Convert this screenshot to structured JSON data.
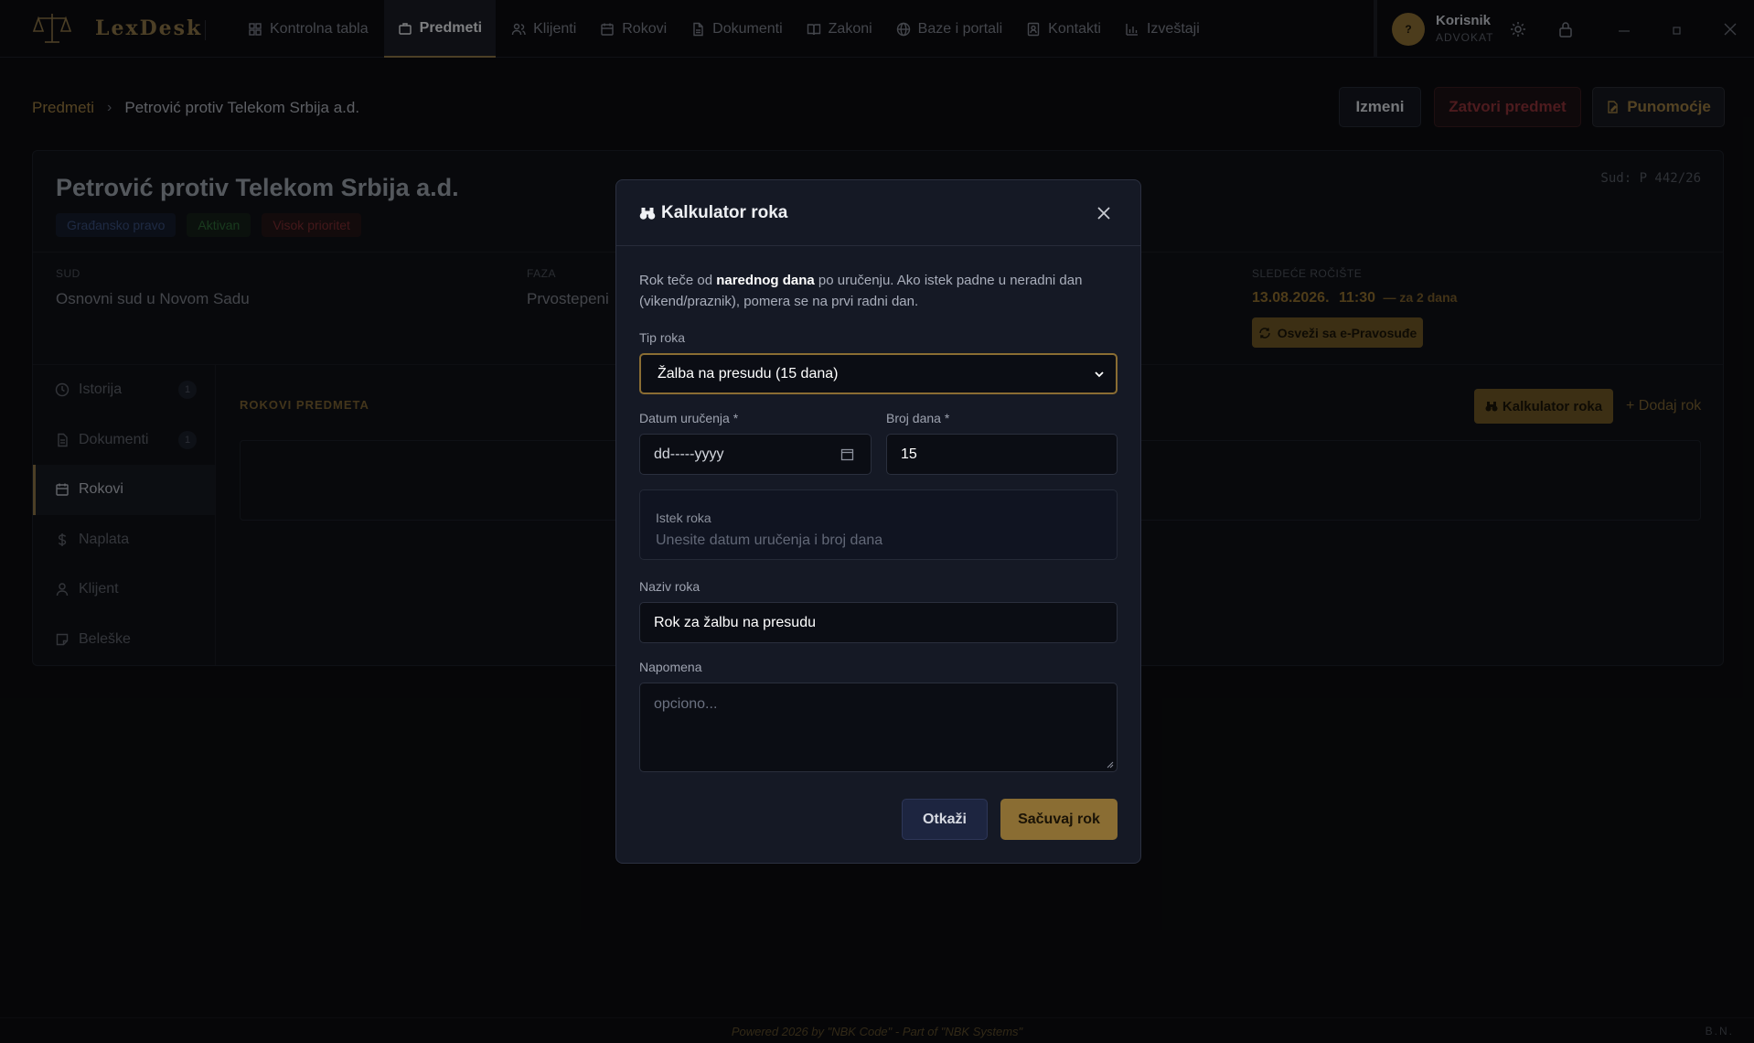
{
  "app": {
    "name": "LexDesk"
  },
  "nav": {
    "items": [
      {
        "label": "Kontrolna tabla",
        "icon": "dashboard-icon"
      },
      {
        "label": "Predmeti",
        "icon": "briefcase-icon"
      },
      {
        "label": "Klijenti",
        "icon": "users-icon"
      },
      {
        "label": "Rokovi",
        "icon": "calendar-icon"
      },
      {
        "label": "Dokumenti",
        "icon": "file-icon"
      },
      {
        "label": "Zakoni",
        "icon": "book-icon"
      },
      {
        "label": "Baze i portali",
        "icon": "globe-icon"
      },
      {
        "label": "Kontakti",
        "icon": "contact-icon"
      },
      {
        "label": "Izveštaji",
        "icon": "bar-chart-icon"
      }
    ],
    "active": "Predmeti"
  },
  "user": {
    "avatar": "?",
    "name": "Korisnik",
    "role": "ADVOKAT"
  },
  "breadcrumb": {
    "parent": "Predmeti",
    "current": "Petrović protiv Telekom Srbija a.d."
  },
  "actions": {
    "izmeni": "Izmeni",
    "zatvori": "Zatvori predmet",
    "punomocje": "Punomoćje"
  },
  "case": {
    "title": "Petrović protiv Telekom Srbija a.d.",
    "sud_code": "Sud: P 442/26",
    "badges": [
      "Građansko pravo",
      "Aktivan",
      "Visok prioritet"
    ],
    "sud_label": "SUD",
    "sud_value": "Osnovni sud u Novom Sadu",
    "faza_label": "FAZA",
    "faza_value": "Prvostepeni",
    "next_label": "SLEDEĆE ROČIŠTE",
    "next_date": "13.08.2026.",
    "next_time": "11:30",
    "next_rel": "— za 2 dana",
    "refresh_label": "Osveži sa e-Pravosuđe"
  },
  "sidebar": {
    "items": [
      {
        "label": "Istorija",
        "count": "1",
        "icon": "clock-icon"
      },
      {
        "label": "Dokumenti",
        "count": "1",
        "icon": "document-icon"
      },
      {
        "label": "Rokovi",
        "count": "",
        "icon": "calendar-icon"
      },
      {
        "label": "Naplata",
        "count": "",
        "icon": "dollar-icon"
      },
      {
        "label": "Klijent",
        "count": "",
        "icon": "user-icon"
      },
      {
        "label": "Beleške",
        "count": "",
        "icon": "note-icon"
      }
    ],
    "active": "Rokovi"
  },
  "rokovi": {
    "title": "ROKOVI PREDMETA",
    "kalkulator": "Kalkulator roka",
    "dodaj": "+ Dodaj rok"
  },
  "modal": {
    "title": "Kalkulator roka",
    "info_1": "Rok teče od ",
    "info_bold": "narednog dana",
    "info_2": " po uručenju. Ako istek padne u neradni dan (vikend/praznik), pomera se na prvi radni dan.",
    "tip_label": "Tip roka",
    "tip_value": "Žalba na presudu (15 dana)",
    "datum_label": "Datum uručenja *",
    "datum_placeholder": "dd-----yyyy",
    "broj_label": "Broj dana *",
    "broj_value": "15",
    "istek_label": "Istek roka",
    "istek_value": "Unesite datum uručenja i broj dana",
    "naziv_label": "Naziv roka",
    "naziv_value": "Rok za žalbu na presudu",
    "napomena_label": "Napomena",
    "napomena_placeholder": "opciono...",
    "cancel": "Otkaži",
    "save": "Sačuvaj rok"
  },
  "footer": {
    "text": "Powered 2026 by \"NBK Code\" - Part of \"NBK Systems\"",
    "initials": "B.N."
  },
  "colors": {
    "accent": "#8a6d33",
    "background": "#0b0c0f",
    "modal": "#151925"
  }
}
